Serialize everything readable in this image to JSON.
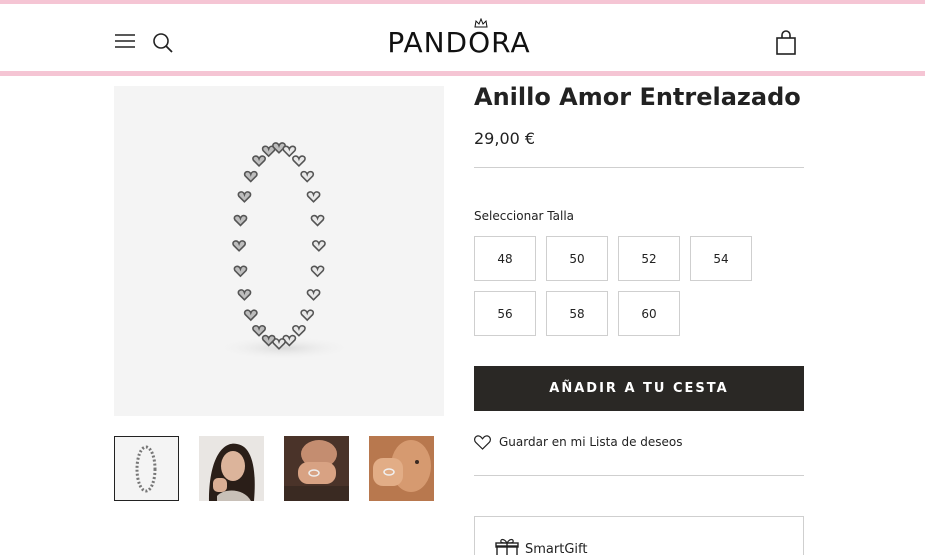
{
  "header": {
    "brand": "PANDORA"
  },
  "product": {
    "title": "Anillo Amor Entrelazado",
    "price": "29,00 €",
    "size_label": "Seleccionar Talla",
    "sizes": [
      "48",
      "50",
      "52",
      "54",
      "56",
      "58",
      "60"
    ],
    "add_to_cart": "AÑADIR A TU CESTA",
    "wishlist": "Guardar en mi Lista de deseos",
    "smartgift": "SmartGift"
  },
  "gallery": {
    "thumbnails": [
      "ring-product-thumb",
      "model-face-thumb",
      "hand-ring-thumb",
      "hand-face-thumb"
    ],
    "active_index": 0
  },
  "colors": {
    "accent_pink": "#f5c5d4",
    "button_dark": "#2a2825"
  },
  "icons": [
    "menu-icon",
    "search-icon",
    "crown-icon",
    "shopping-bag-icon",
    "heart-icon",
    "gift-icon"
  ]
}
